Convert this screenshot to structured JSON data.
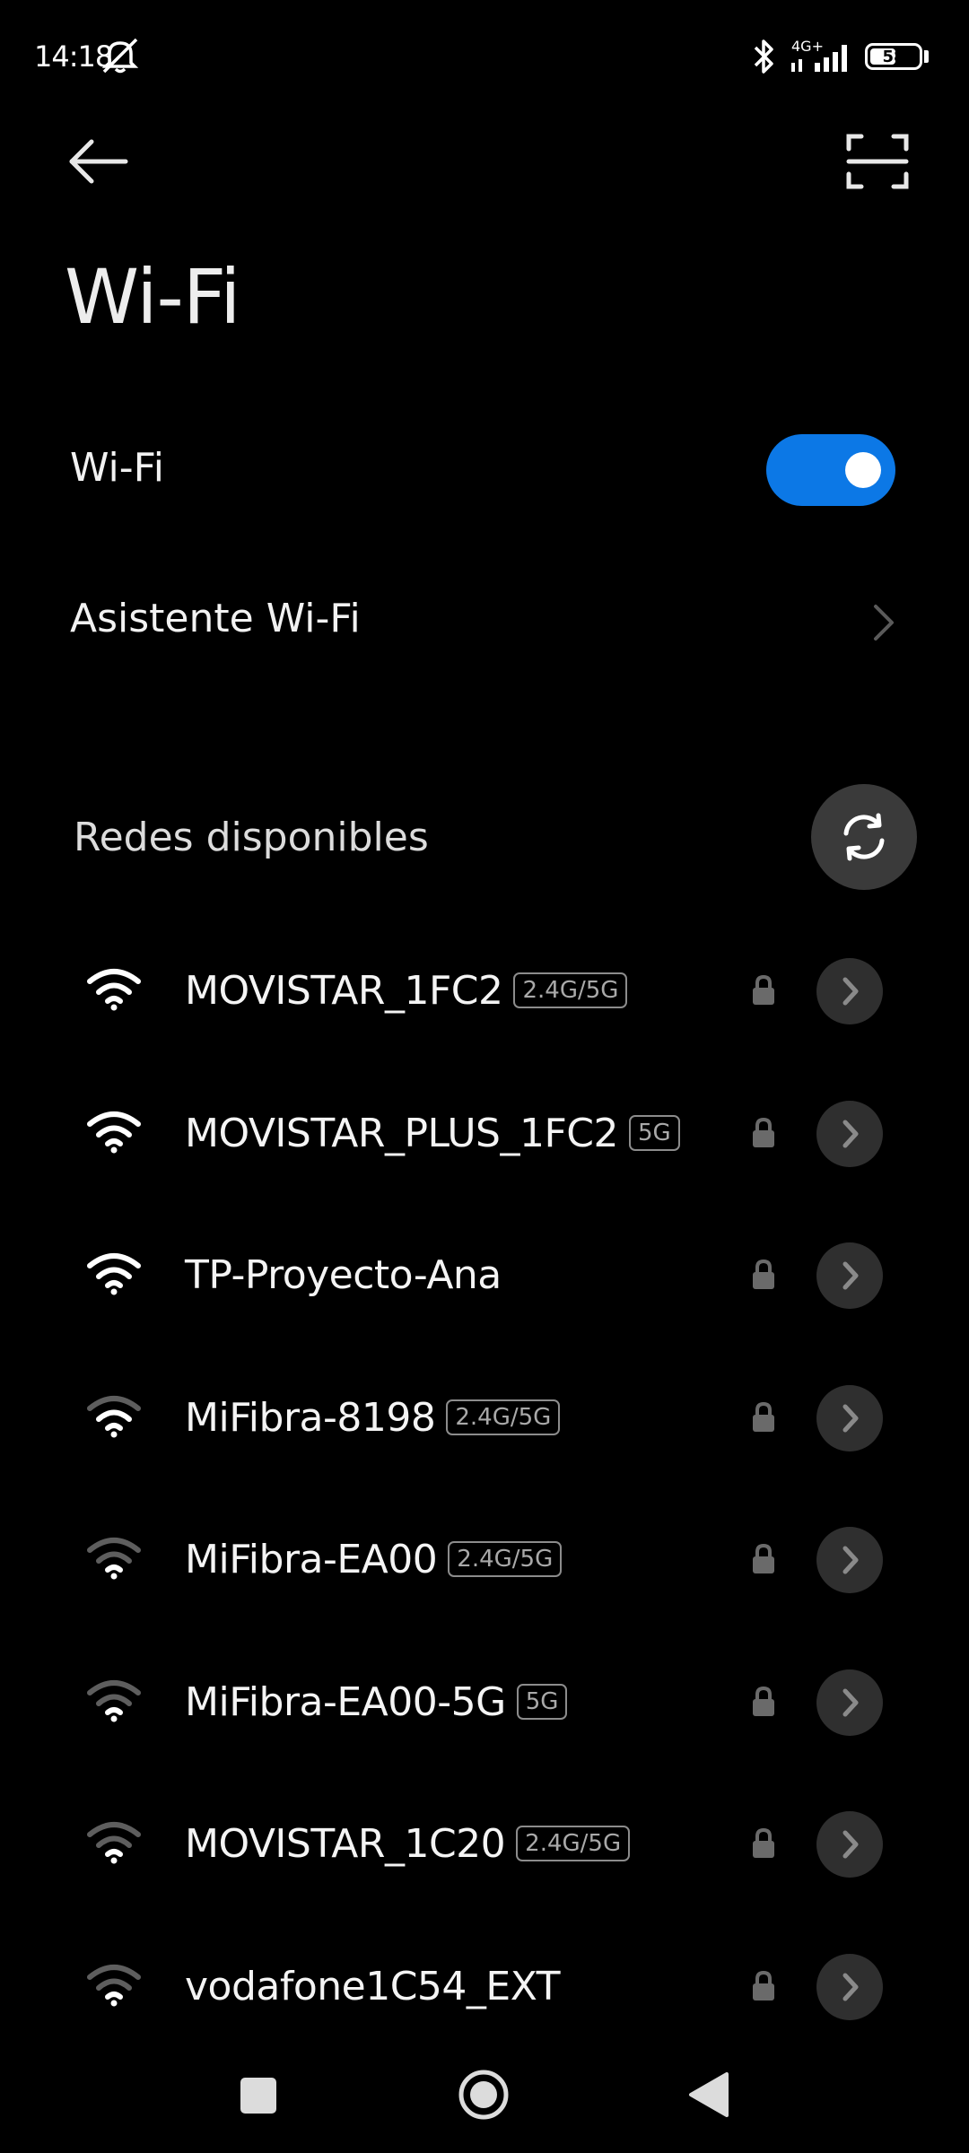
{
  "status_bar": {
    "time": "14:18",
    "network_type": "4G+",
    "battery": "58",
    "battery_level": 0.58,
    "icons": [
      "mute-notifications-icon",
      "bluetooth-icon",
      "signal-icon",
      "battery-icon"
    ]
  },
  "header": {
    "back_icon": "arrow-left-icon",
    "scan_icon": "scan-qr-icon",
    "title": "Wi-Fi"
  },
  "wifi_toggle": {
    "label": "Wi-Fi",
    "enabled": true,
    "accent_color": "#0c78e6"
  },
  "assistant": {
    "label": "Asistente Wi-Fi",
    "icon": "chevron-right-icon"
  },
  "available": {
    "title": "Redes disponibles",
    "refresh_icon": "refresh-icon"
  },
  "networks": [
    {
      "name": "MOVISTAR_1FC2",
      "band": "2.4G/5G",
      "signal": 3,
      "locked": true
    },
    {
      "name": "MOVISTAR_PLUS_1FC2",
      "band": "5G",
      "signal": 3,
      "locked": true
    },
    {
      "name": "TP-Proyecto-Ana",
      "band": "",
      "signal": 3,
      "locked": true
    },
    {
      "name": "MiFibra-8198",
      "band": "2.4G/5G",
      "signal": 2,
      "locked": true
    },
    {
      "name": "MiFibra-EA00",
      "band": "2.4G/5G",
      "signal": 1,
      "locked": true
    },
    {
      "name": "MiFibra-EA00-5G",
      "band": "5G",
      "signal": 1,
      "locked": true
    },
    {
      "name": "MOVISTAR_1C20",
      "band": "2.4G/5G",
      "signal": 1,
      "locked": true
    },
    {
      "name": "vodafone1C54_EXT",
      "band": "",
      "signal": 1,
      "locked": true
    }
  ],
  "nav_bar": {
    "icons": [
      "recents-square-icon",
      "home-circle-icon",
      "back-triangle-icon"
    ]
  }
}
